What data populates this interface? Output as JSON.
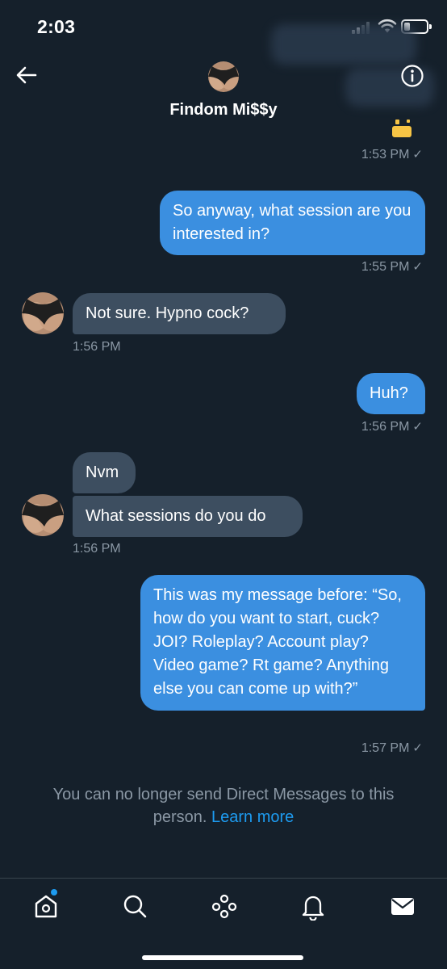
{
  "status_bar": {
    "time": "2:03"
  },
  "header": {
    "title": "Findom Mi$$y"
  },
  "messages": [
    {
      "id": "m1",
      "text": "So anyway, what session are you interested in?",
      "time": "1:55 PM"
    },
    {
      "id": "m2",
      "text": "Not sure. Hypno cock?",
      "time": "1:56 PM"
    },
    {
      "id": "m3",
      "text": "Huh?",
      "time": "1:56 PM"
    },
    {
      "id": "m4",
      "text": "Nvm"
    },
    {
      "id": "m5",
      "text": "What sessions do you do",
      "time": "1:56 PM"
    },
    {
      "id": "m6",
      "text": "This was my message before: “So, how do you want to start, cuck? JOI? Roleplay? Account play? Video game? Rt game? Anything else you can come up with?”",
      "time": "1:57 PM"
    }
  ],
  "previous_time": "1:53 PM",
  "read_check": "✓",
  "notice": {
    "text": "You can no longer send Direct Messages to this person.",
    "link": "Learn more"
  },
  "nav": {
    "items": [
      "home-icon",
      "search-icon",
      "spaces-icon",
      "notifications-icon",
      "messages-icon"
    ],
    "active": "messages-icon"
  },
  "colors": {
    "background": "#15202b",
    "outgoing_bubble": "#3b8fe0",
    "incoming_bubble": "#3d4e60",
    "accent": "#1d9bf0",
    "muted_text": "#8b98a5"
  }
}
